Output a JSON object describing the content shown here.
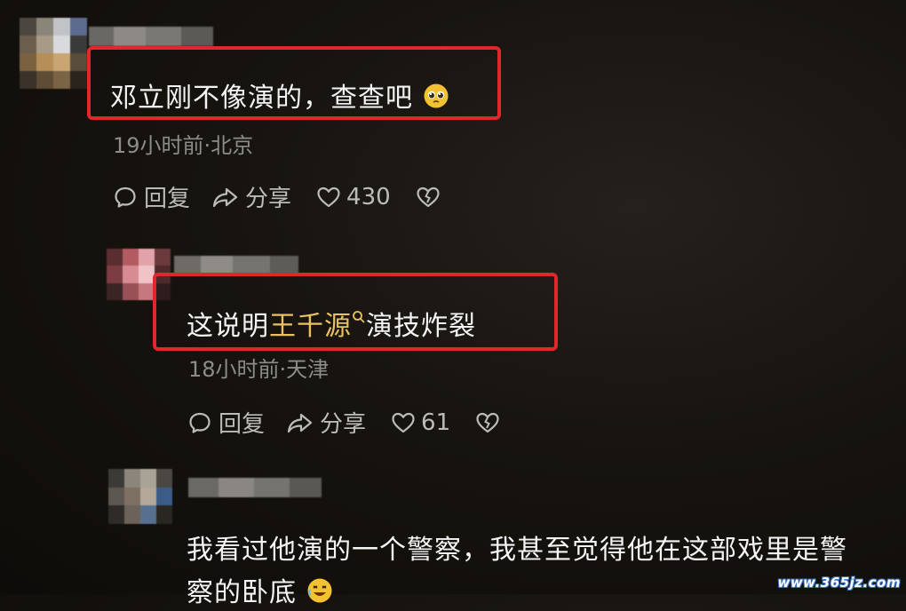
{
  "comments": [
    {
      "text": "邓立刚不像演的，查查吧",
      "emoji": "pleading-face-icon",
      "meta": "19小时前·北京",
      "actions": {
        "reply_label": "回复",
        "share_label": "分享",
        "like_count": "430"
      }
    },
    {
      "text_before": "这说明",
      "mention": "王千源",
      "text_after": "演技炸裂",
      "meta": "18小时前·天津",
      "actions": {
        "reply_label": "回复",
        "share_label": "分享",
        "like_count": "61"
      }
    },
    {
      "text_line1": "我看过他演的一个警察，我甚至觉得他在这部戏里是警",
      "text_line2": "察的卧底",
      "emoji": "rolling-laughing-icon"
    }
  ],
  "colors": {
    "highlight_box": "#e3262b",
    "mention": "#e9c062",
    "meta_text": "#8e8c88",
    "background": "#17140f"
  },
  "watermark": "www.365jz.com"
}
